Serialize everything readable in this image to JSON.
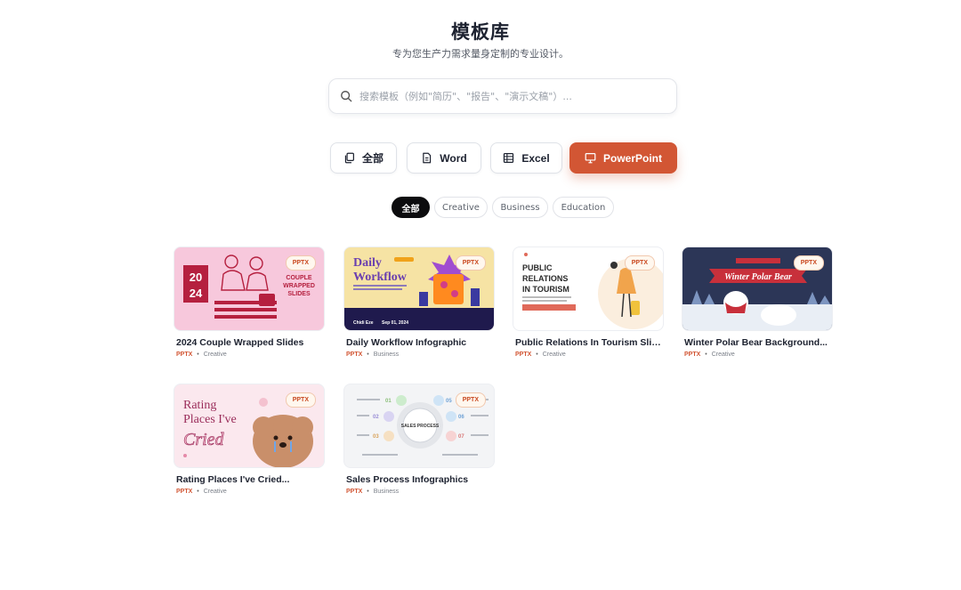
{
  "header": {
    "title": "模板库",
    "subtitle": "专为您生产力需求量身定制的专业设计。"
  },
  "search": {
    "placeholder": "搜索模板（例如\"简历\"、\"报告\"、\"演示文稿\"）..."
  },
  "type_tabs": [
    {
      "label": "全部",
      "icon": "copy-icon",
      "active": false
    },
    {
      "label": "Word",
      "icon": "document-icon",
      "active": false
    },
    {
      "label": "Excel",
      "icon": "table-icon",
      "active": false
    },
    {
      "label": "PowerPoint",
      "icon": "presentation-icon",
      "active": true
    }
  ],
  "chips": [
    {
      "label": "全部",
      "active": true
    },
    {
      "label": "Creative",
      "active": false
    },
    {
      "label": "Business",
      "active": false
    },
    {
      "label": "Education",
      "active": false
    }
  ],
  "templates": [
    {
      "title": "2024 Couple Wrapped Slides",
      "format": "PPTX",
      "category": "Creative",
      "badge": "PPTX",
      "thumb_text": {
        "year_top": "20",
        "year_bottom": "24",
        "line1": "COUPLE",
        "line2": "WRAPPED",
        "line3": "SLIDES"
      }
    },
    {
      "title": "Daily Workflow Infographic",
      "format": "PPTX",
      "category": "Business",
      "badge": "PPTX",
      "thumb_text": {
        "line1": "Daily",
        "line2": "Workflow",
        "name": "Chidi Eze",
        "date": "Sep 01, 2024"
      }
    },
    {
      "title": "Public Relations In Tourism Slides",
      "format": "PPTX",
      "category": "Creative",
      "badge": "PPTX",
      "thumb_text": {
        "line1": "PUBLIC",
        "line2": "RELATIONS",
        "line3": "IN TOURISM"
      }
    },
    {
      "title": "Winter Polar Bear Background...",
      "format": "PPTX",
      "category": "Creative",
      "badge": "PPTX",
      "thumb_text": {
        "line1": "Winter Polar Bear"
      }
    },
    {
      "title": "Rating Places I've Cried...",
      "format": "PPTX",
      "category": "Creative",
      "badge": "PPTX",
      "thumb_text": {
        "line1": "Rating",
        "line2": "Places I've",
        "line3": "Cried"
      }
    },
    {
      "title": "Sales Process Infographics",
      "format": "PPTX",
      "category": "Business",
      "badge": "PPTX",
      "thumb_text": {
        "center": "SALES PROCESS",
        "n1": "01",
        "n2": "02",
        "n3": "03",
        "n4": "05",
        "n5": "06",
        "n6": "07"
      }
    }
  ],
  "meta_separator": "•",
  "colors": {
    "accent": "#d25634",
    "active_chip": "#0c0c0e"
  }
}
